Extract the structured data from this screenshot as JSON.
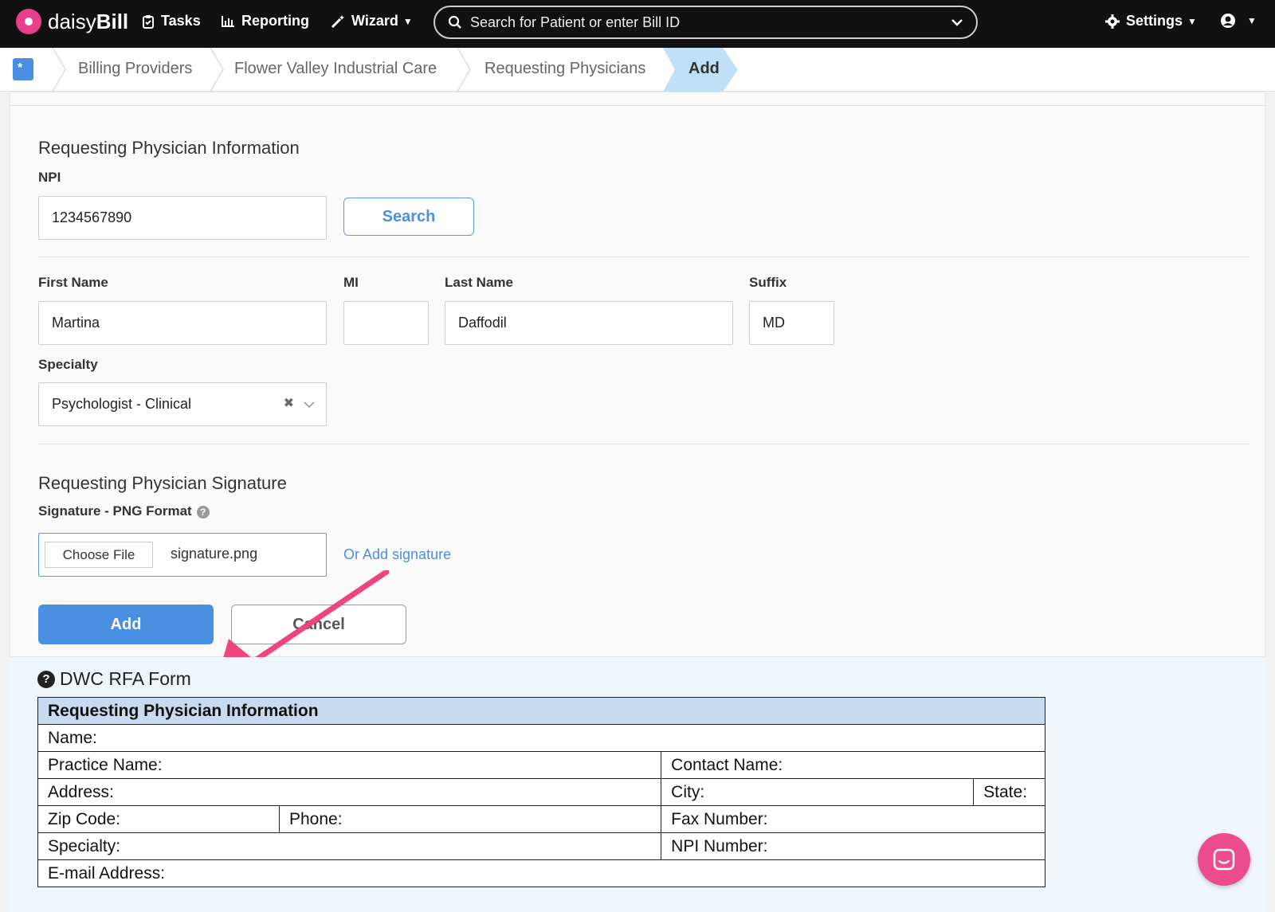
{
  "topnav": {
    "logo_text_light": "daisy",
    "logo_text_bold": "Bill",
    "tasks_label": "Tasks",
    "reporting_label": "Reporting",
    "wizard_label": "Wizard",
    "search_placeholder": "Search for Patient or enter Bill ID",
    "settings_label": "Settings"
  },
  "breadcrumb": {
    "items": [
      "Billing Providers",
      "Flower Valley Industrial Care",
      "Requesting Physicians"
    ],
    "active": "Add"
  },
  "form": {
    "info_title": "Requesting Physician Information",
    "npi_label": "NPI",
    "npi_value": "1234567890",
    "search_button": "Search",
    "first_name_label": "First Name",
    "first_name_value": "Martina",
    "mi_label": "MI",
    "mi_value": "",
    "last_name_label": "Last Name",
    "last_name_value": "Daffodil",
    "suffix_label": "Suffix",
    "suffix_value": "MD",
    "specialty_label": "Specialty",
    "specialty_value": "Psychologist - Clinical",
    "signature_title": "Requesting Physician Signature",
    "signature_label": "Signature - PNG Format",
    "choose_file_label": "Choose File",
    "file_name": "signature.png",
    "add_signature_link": "Or Add signature",
    "add_button": "Add",
    "cancel_button": "Cancel"
  },
  "rfa": {
    "title": "DWC RFA Form",
    "header": "Requesting Physician Information",
    "name": "Name:",
    "practice_name": "Practice Name:",
    "contact_name": "Contact Name:",
    "address": "Address:",
    "city": "City:",
    "state": "State:",
    "zip": "Zip Code:",
    "phone": "Phone:",
    "fax": "Fax Number:",
    "specialty": "Specialty:",
    "npi_number": "NPI Number:",
    "email": "E-mail Address:"
  },
  "colors": {
    "accent": "#4a90e2",
    "annotation_arrow": "#f0447e",
    "nav_bg": "#111111"
  }
}
